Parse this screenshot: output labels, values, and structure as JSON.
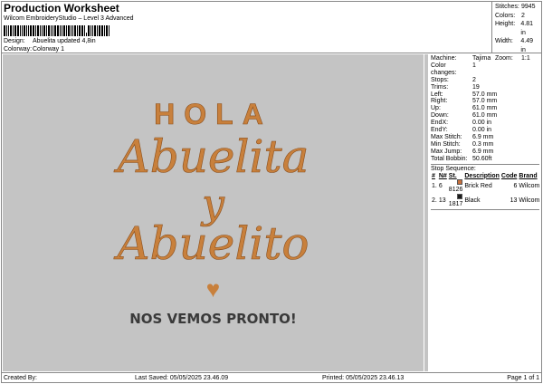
{
  "header": {
    "title": "Production Worksheet",
    "subtitle": "Wilcom EmbroideryStudio – Level 3 Advanced",
    "design_label": "Design:",
    "design_value": "Abuelita updated 4,8in",
    "colorway_label": "Colorway:",
    "colorway_value": "Colorway 1"
  },
  "stats": [
    {
      "label": "Stitches:",
      "value": "9945"
    },
    {
      "label": "Colors:",
      "value": "2"
    },
    {
      "label": "Height:",
      "value": "4.81 in"
    },
    {
      "label": "Width:",
      "value": "4.49 in"
    },
    {
      "label": "Zoom:",
      "value": "1:1"
    }
  ],
  "details": [
    {
      "label": "Machine:",
      "value": "Tajima"
    },
    {
      "label": "Color changes:",
      "value": "1"
    },
    {
      "label": "Stops:",
      "value": "2"
    },
    {
      "label": "Trims:",
      "value": "19"
    },
    {
      "label": "Left:",
      "value": "57.0 mm"
    },
    {
      "label": "Right:",
      "value": "57.0 mm"
    },
    {
      "label": "Up:",
      "value": "61.0 mm"
    },
    {
      "label": "Down:",
      "value": "61.0 mm"
    },
    {
      "label": "EndX:",
      "value": "0.00 in"
    },
    {
      "label": "EndY:",
      "value": "0.00 in"
    },
    {
      "label": "Max Stitch:",
      "value": "6.9 mm"
    },
    {
      "label": "Min Stitch:",
      "value": "0.3 mm"
    },
    {
      "label": "Max Jump:",
      "value": "6.9 mm"
    },
    {
      "label": "Total Bobbin:",
      "value": "50.60ft"
    }
  ],
  "stop_sequence": {
    "title": "Stop Sequence:",
    "headers": [
      "#",
      "N#",
      "St.",
      "Description",
      "Code",
      "Brand"
    ],
    "rows": [
      {
        "idx": "1.",
        "n": "6",
        "color": "#c8703c",
        "st": "8126",
        "desc": "Brick Red",
        "code": "6",
        "brand": "Wilcom"
      },
      {
        "idx": "2.",
        "n": "13",
        "color": "#1a1a1a",
        "st": "1817",
        "desc": "Black",
        "code": "13",
        "brand": "Wilcom"
      }
    ]
  },
  "design": {
    "line1": "HOLA",
    "line2": "Abuelita",
    "line3": "y",
    "line4": "Abuelito",
    "line5": "NOS VEMOS PRONTO!",
    "thread_color": "#c8803c",
    "text_color": "#3a3a3a"
  },
  "footer": {
    "created_by": "Created By:",
    "last_saved": "Last Saved: 05/05/2025 23.46.09",
    "printed": "Printed: 05/05/2025 23.46.13",
    "page": "Page 1 of 1"
  }
}
